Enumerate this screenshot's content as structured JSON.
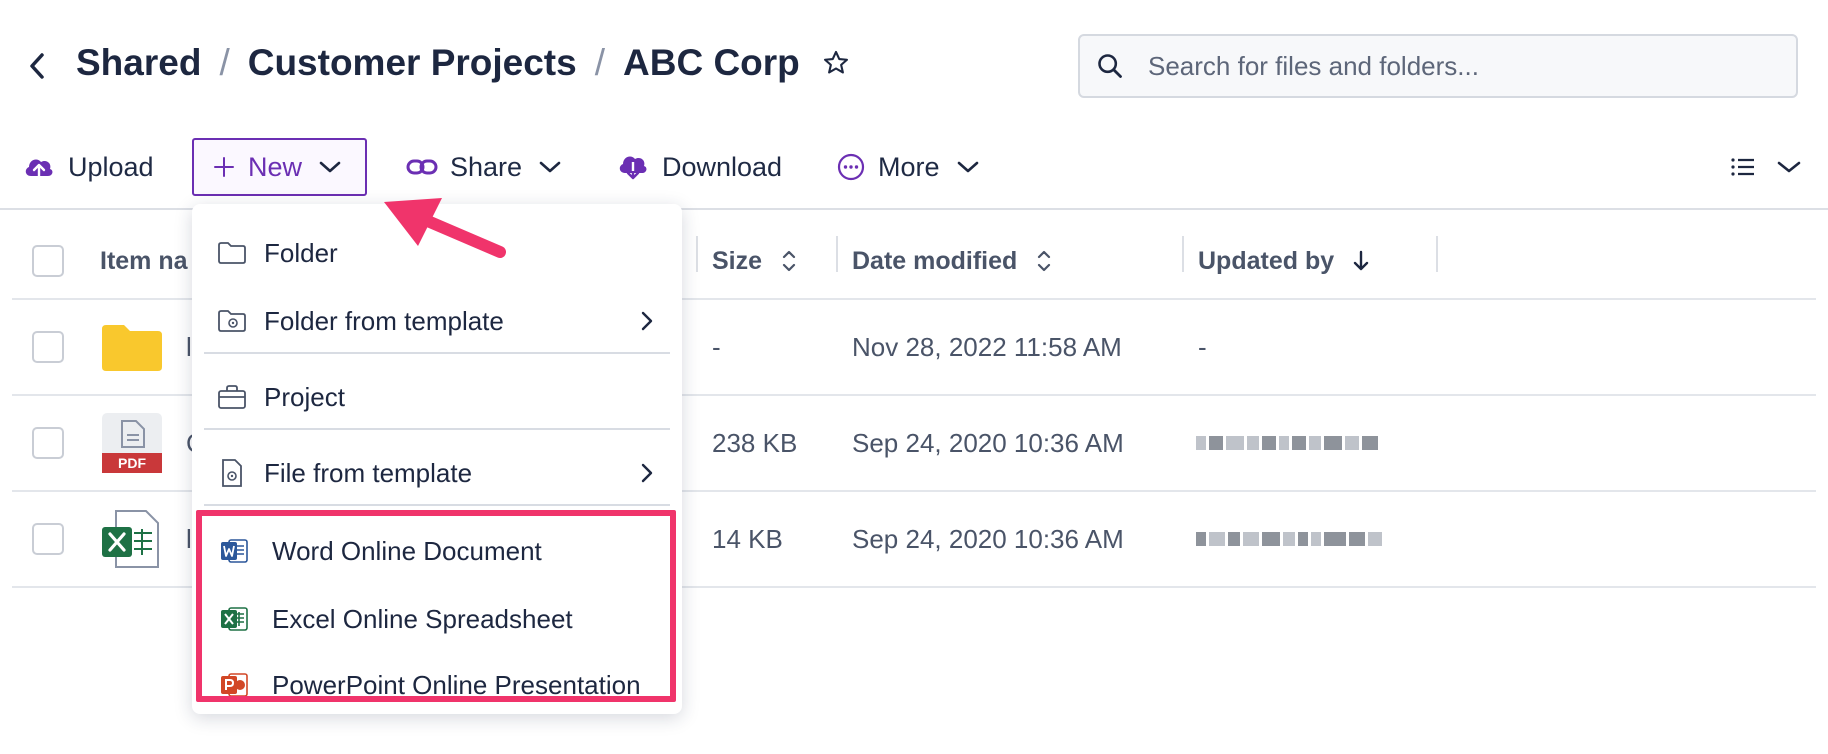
{
  "header": {
    "breadcrumb": [
      "Shared",
      "Customer Projects",
      "ABC Corp"
    ],
    "separator": "/",
    "search_placeholder": "Search for files and folders..."
  },
  "toolbar": {
    "upload": "Upload",
    "new": "New",
    "share": "Share",
    "download": "Download",
    "more": "More"
  },
  "table": {
    "columns": {
      "item_name": "Item na",
      "size": "Size",
      "date_modified": "Date modified",
      "updated_by": "Updated by"
    },
    "rows": [
      {
        "name_partial": "l",
        "size": "-",
        "date": "Nov 28, 2022 11:58 AM",
        "updated_by": "-"
      },
      {
        "name_partial": "C",
        "size": "238 KB",
        "date": "Sep 24, 2020 10:36 AM",
        "updated_by": ""
      },
      {
        "name_partial": "l",
        "size": "14 KB",
        "date": "Sep 24, 2020 10:36 AM",
        "updated_by": ""
      }
    ]
  },
  "new_menu": {
    "items": [
      {
        "label": "Folder",
        "icon": "folder-icon"
      },
      {
        "label": "Folder from template",
        "icon": "folder-template-icon"
      },
      {
        "label": "Project",
        "icon": "briefcase-icon"
      },
      {
        "label": "File from template",
        "icon": "file-template-icon"
      },
      {
        "label": "Word Online Document",
        "icon": "word-icon"
      },
      {
        "label": "Excel Online Spreadsheet",
        "icon": "excel-icon"
      },
      {
        "label": "PowerPoint Online Presentation",
        "icon": "powerpoint-icon"
      }
    ]
  },
  "pdf_badge": "PDF",
  "colors": {
    "accent": "#6b2fb3",
    "highlight": "#f0346b",
    "folder": "#f9c82d",
    "pdf": "#c9383a",
    "excel": "#1e7145",
    "word": "#2b579a",
    "powerpoint": "#d24726"
  }
}
